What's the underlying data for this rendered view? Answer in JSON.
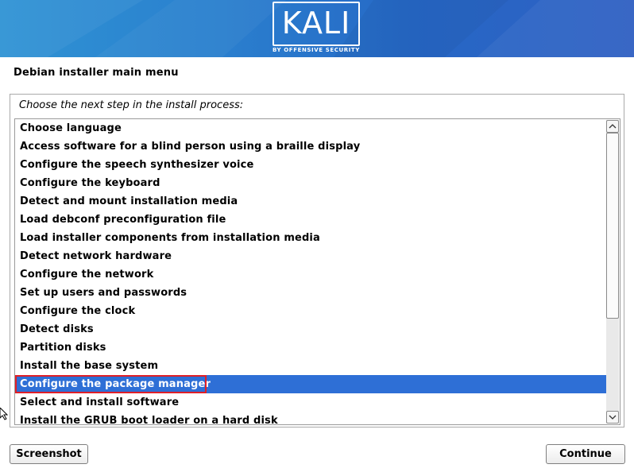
{
  "banner": {
    "logo_text": "KALI",
    "logo_subtitle": "BY OFFENSIVE SECURITY"
  },
  "page_title": "Debian installer main menu",
  "prompt": "Choose the next step in the install process:",
  "menu": {
    "selected_index": 14,
    "items": [
      "Choose language",
      "Access software for a blind person using a braille display",
      "Configure the speech synthesizer voice",
      "Configure the keyboard",
      "Detect and mount installation media",
      "Load debconf preconfiguration file",
      "Load installer components from installation media",
      "Detect network hardware",
      "Configure the network",
      "Set up users and passwords",
      "Configure the clock",
      "Detect disks",
      "Partition disks",
      "Install the base system",
      "Configure the package manager",
      "Select and install software",
      "Install the GRUB boot loader on a hard disk"
    ]
  },
  "buttons": {
    "screenshot": "Screenshot",
    "continue": "Continue"
  },
  "colors": {
    "selection": "#2e6fd6",
    "highlight_border": "#e01f27",
    "banner_start": "#2f93d4",
    "banner_end": "#2f5fc2"
  }
}
